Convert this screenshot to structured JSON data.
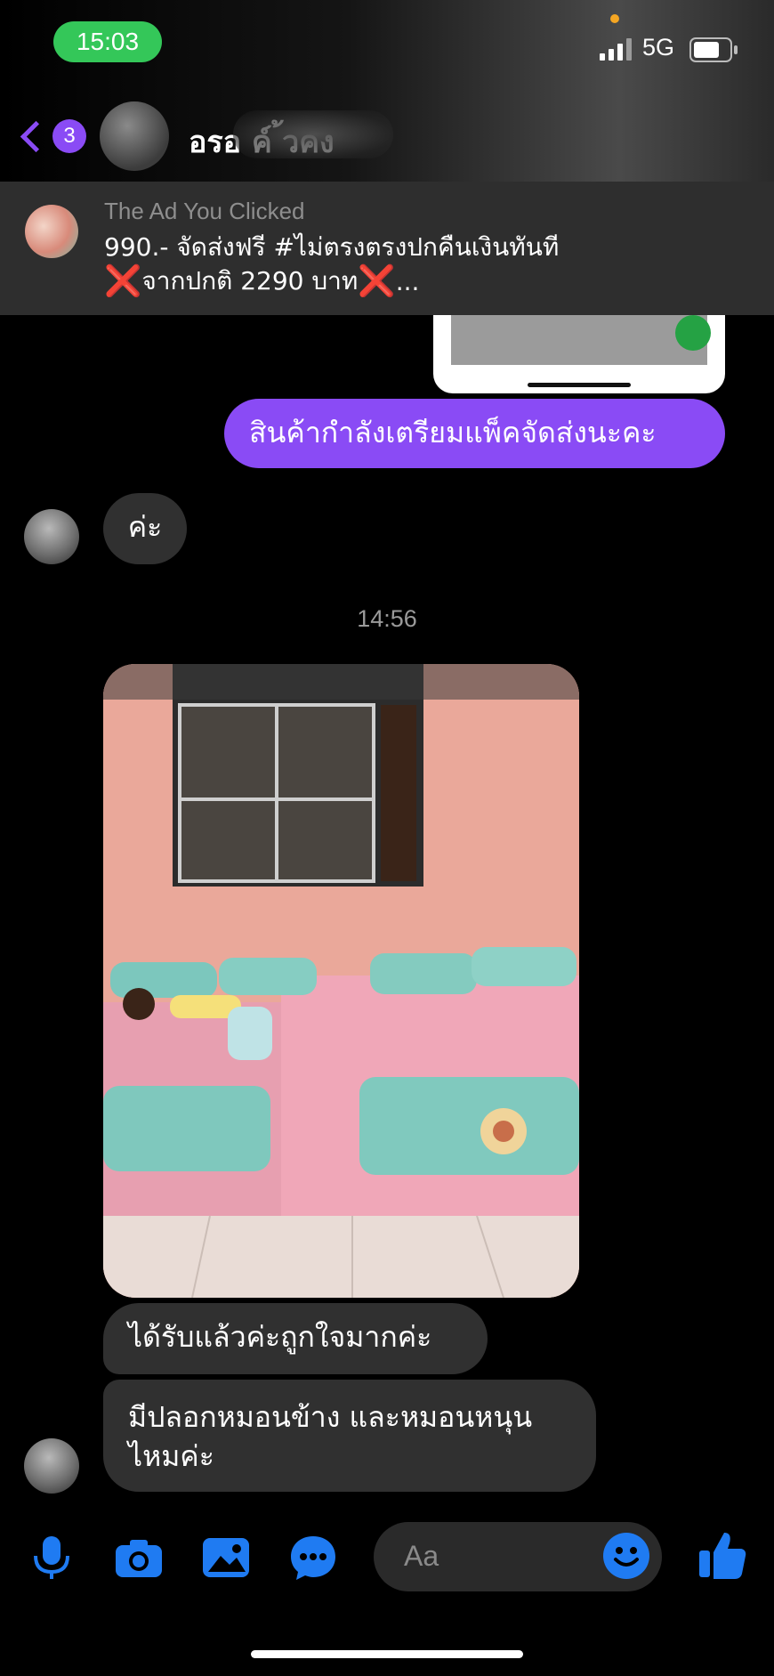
{
  "status_bar": {
    "time": "15:03",
    "network": "5G"
  },
  "header": {
    "unread_count": "3",
    "contact_name": "อรอ      ค์   ้วคง"
  },
  "ad_banner": {
    "label": "The Ad You Clicked",
    "line1": "990.- จัดส่งฟรี #ไม่ตรงตรงปกคืนเงินทันที",
    "line2_mark": "❌",
    "line2_text": "จากปกติ 2290 บาท",
    "line2_suffix": "..."
  },
  "messages": [
    {
      "from": "me",
      "text": "สินค้ากำลังเตรียมแพ็คจัดส่งนะคะ"
    },
    {
      "from": "contact",
      "text": "ค่ะ"
    },
    {
      "from": "contact",
      "text": "ได้รับแล้วค่ะถูกใจมากค่ะ"
    },
    {
      "from": "contact",
      "text": "มีปลอกหมอนข้าง และหมอนหนุน ไหมค่ะ"
    }
  ],
  "timestamp": "14:56",
  "composer": {
    "placeholder": "Aa",
    "icons": [
      "microphone-icon",
      "camera-icon",
      "gallery-icon",
      "chat-bubble-icon",
      "emoji-icon",
      "thumbs-up-icon"
    ]
  },
  "colors": {
    "accent": "#8a4bf5",
    "blue": "#1f7bf2",
    "bubble_in": "#303030",
    "status_green": "#34c759"
  }
}
